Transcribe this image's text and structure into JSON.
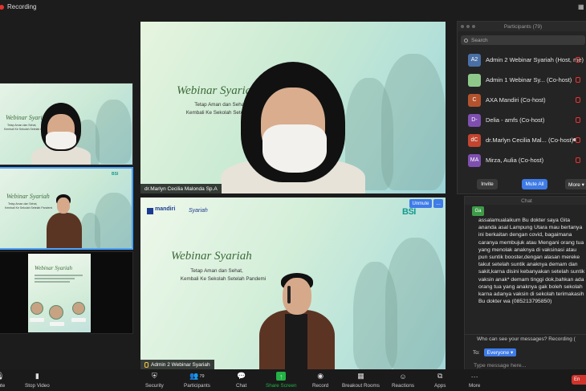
{
  "topbar": {
    "recording_label": "Recording"
  },
  "tiles": {
    "tile1": {
      "title": "Webinar Syariah",
      "sub1": "Tetap Aman dan Sehat,",
      "sub2": "Kembali Ke Sekolah Setelah Pandemi"
    },
    "tile2": {
      "title": "Webinar Syariah",
      "sub1": "Tetap Aman dan Sehat,",
      "sub2": "Kembali Ke Sekolah Setelah Pandemi",
      "bsi": "BSI"
    },
    "tile3": {
      "title": "Webinar Syariah"
    }
  },
  "main_top": {
    "title": "Webinar Syariah",
    "sub1": "Tetap Aman dan Sehat,",
    "sub2": "Kembali Ke Sekolah Setelah Pandemi",
    "name": "dr.Marlyn Cecilia Malonda Sp.A"
  },
  "main_bottom": {
    "brand_mandiri": "mandiri",
    "brand_syariah": "Syariah",
    "brand_bsi": "BSI",
    "title": "Webinar Syariah",
    "sub1": "Tetap Aman dan Sehat,",
    "sub2": "Kembali Ke Sekolah Setelah Pandemi",
    "unmute_label": "Unmute",
    "more_label": "...",
    "name": "Admin 2 Webinar Syariah"
  },
  "participants": {
    "header": "Participants (79)",
    "search_placeholder": "Search",
    "rows": [
      {
        "initials": "A2",
        "color": "#4a6fa5",
        "name": "Admin 2 Webinar Syariah",
        "role": "(Host, me)"
      },
      {
        "initials": "",
        "color": "#8fc98a",
        "name": "Admin 1 Webinar Sy...",
        "role": "(Co-host)"
      },
      {
        "initials": "C",
        "color": "#b3532e",
        "name": "AXA Mandiri",
        "role": "(Co-host)"
      },
      {
        "initials": "D-",
        "color": "#7f4fb0",
        "name": "Delia - amfs",
        "role": "(Co-host)"
      },
      {
        "initials": "dC",
        "color": "#c2452f",
        "name": "dr.Marlyn Cecilia Mal...",
        "role": "(Co-host)"
      },
      {
        "initials": "MA",
        "color": "#7f4fb0",
        "name": "Mirza,  Aulia",
        "role": "(Co-host)"
      }
    ],
    "invite_label": "Invite",
    "mute_all_label": "Mute All",
    "more_label": "More ▾"
  },
  "chat": {
    "header": "Chat",
    "sender_initials": "Ga",
    "message": "assalamualaikum Bu dokter saya Gita ananda asal Lampung Utara mau bertanya ini berkaitan dengan covid, bagaimana caranya membujuk atau Mengani orang tua yang menolak anaknya di vaksinasi atau pun suntik booster,dengan alasan mereke takut setelah suntik anaknya demam dan sakit,karna disini kebanyakan setelah suntik vaksin anak* demam tinggi dok,bahkan ada orang tua yang anaknya gak boleh sekolah karna adanya vaksin di sekolah terimakasih Bu dokter wa (085213795850)",
    "who_can_see": "Who can see your messages? Recording (",
    "to_label": "To:",
    "to_value": "Everyone ▾",
    "input_placeholder": "Type message here..."
  },
  "toolbar": {
    "items": [
      {
        "label": "nute",
        "icon": "mic-icon"
      },
      {
        "label": "Stop Video",
        "icon": "camera-icon"
      },
      {
        "label": "Security",
        "icon": "shield-icon"
      },
      {
        "label": "Participants",
        "icon": "people-icon",
        "count": "79"
      },
      {
        "label": "Chat",
        "icon": "chat-icon"
      },
      {
        "label": "Share Screen",
        "icon": "share-icon"
      },
      {
        "label": "Record",
        "icon": "record-icon"
      },
      {
        "label": "Breakout Rooms",
        "icon": "grid-icon"
      },
      {
        "label": "Reactions",
        "icon": "smile-icon"
      },
      {
        "label": "Apps",
        "icon": "apps-icon"
      },
      {
        "label": "More",
        "icon": "dots-icon"
      }
    ],
    "end_label": "En"
  }
}
